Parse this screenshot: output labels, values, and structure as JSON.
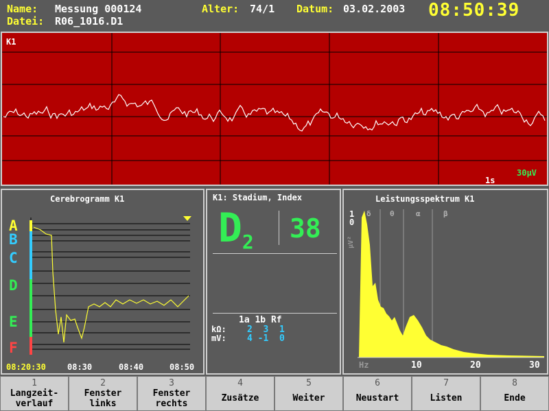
{
  "header": {
    "name_label": "Name:",
    "name_value": "Messung 000124",
    "file_label": "Datei:",
    "file_value": "R06_1016.D1",
    "age_label": "Alter:",
    "age_value": "74/1",
    "date_label": "Datum:",
    "date_value": "03.02.2003",
    "clock": "08:50:39"
  },
  "eeg": {
    "channel": "K1",
    "time_scale": "1s",
    "amp_scale": "30µV"
  },
  "cerebrogram": {
    "title": "Cerebrogramm K1",
    "stages": [
      {
        "label": "A",
        "color": "#ffff33"
      },
      {
        "label": "B",
        "color": "#33ccff"
      },
      {
        "label": "C",
        "color": "#33ccff"
      },
      {
        "label": "D",
        "color": "#33ee55"
      },
      {
        "label": "E",
        "color": "#33ee55"
      },
      {
        "label": "F",
        "color": "#ff4444"
      }
    ],
    "time_labels": [
      "08:20:30",
      "08:30",
      "08:40",
      "08:50"
    ]
  },
  "stadium": {
    "title": "K1: Stadium, Index",
    "stage_letter": "D",
    "stage_sub": "2",
    "index": "38",
    "imp_header": "1a 1b Rf",
    "kohm_label": "kΩ:",
    "kohm_values": "2  3  1",
    "mv_label": "mV:",
    "mv_values": "4 -1  0"
  },
  "spectrum": {
    "title": "Leistungsspektrum K1",
    "y_top": "1",
    "y_zero": "0",
    "y_unit": "µV²",
    "band_labels": [
      "δ",
      "θ",
      "α",
      "β"
    ],
    "x_unit": "Hz",
    "x_ticks": [
      "10",
      "20",
      "30"
    ]
  },
  "function_keys": [
    {
      "num": "1",
      "label": "Langzeit-\nverlauf"
    },
    {
      "num": "2",
      "label": "Fenster\nlinks"
    },
    {
      "num": "3",
      "label": "Fenster\nrechts"
    },
    {
      "num": "4",
      "label": "Zusätze"
    },
    {
      "num": "5",
      "label": "Weiter"
    },
    {
      "num": "6",
      "label": "Neustart"
    },
    {
      "num": "7",
      "label": "Listen"
    },
    {
      "num": "8",
      "label": "Ende"
    }
  ],
  "colors": {
    "accent_yellow": "#ffff33",
    "eeg_background": "#b30000",
    "stage_green": "#33ee55",
    "impedance_cyan": "#33ccff"
  }
}
